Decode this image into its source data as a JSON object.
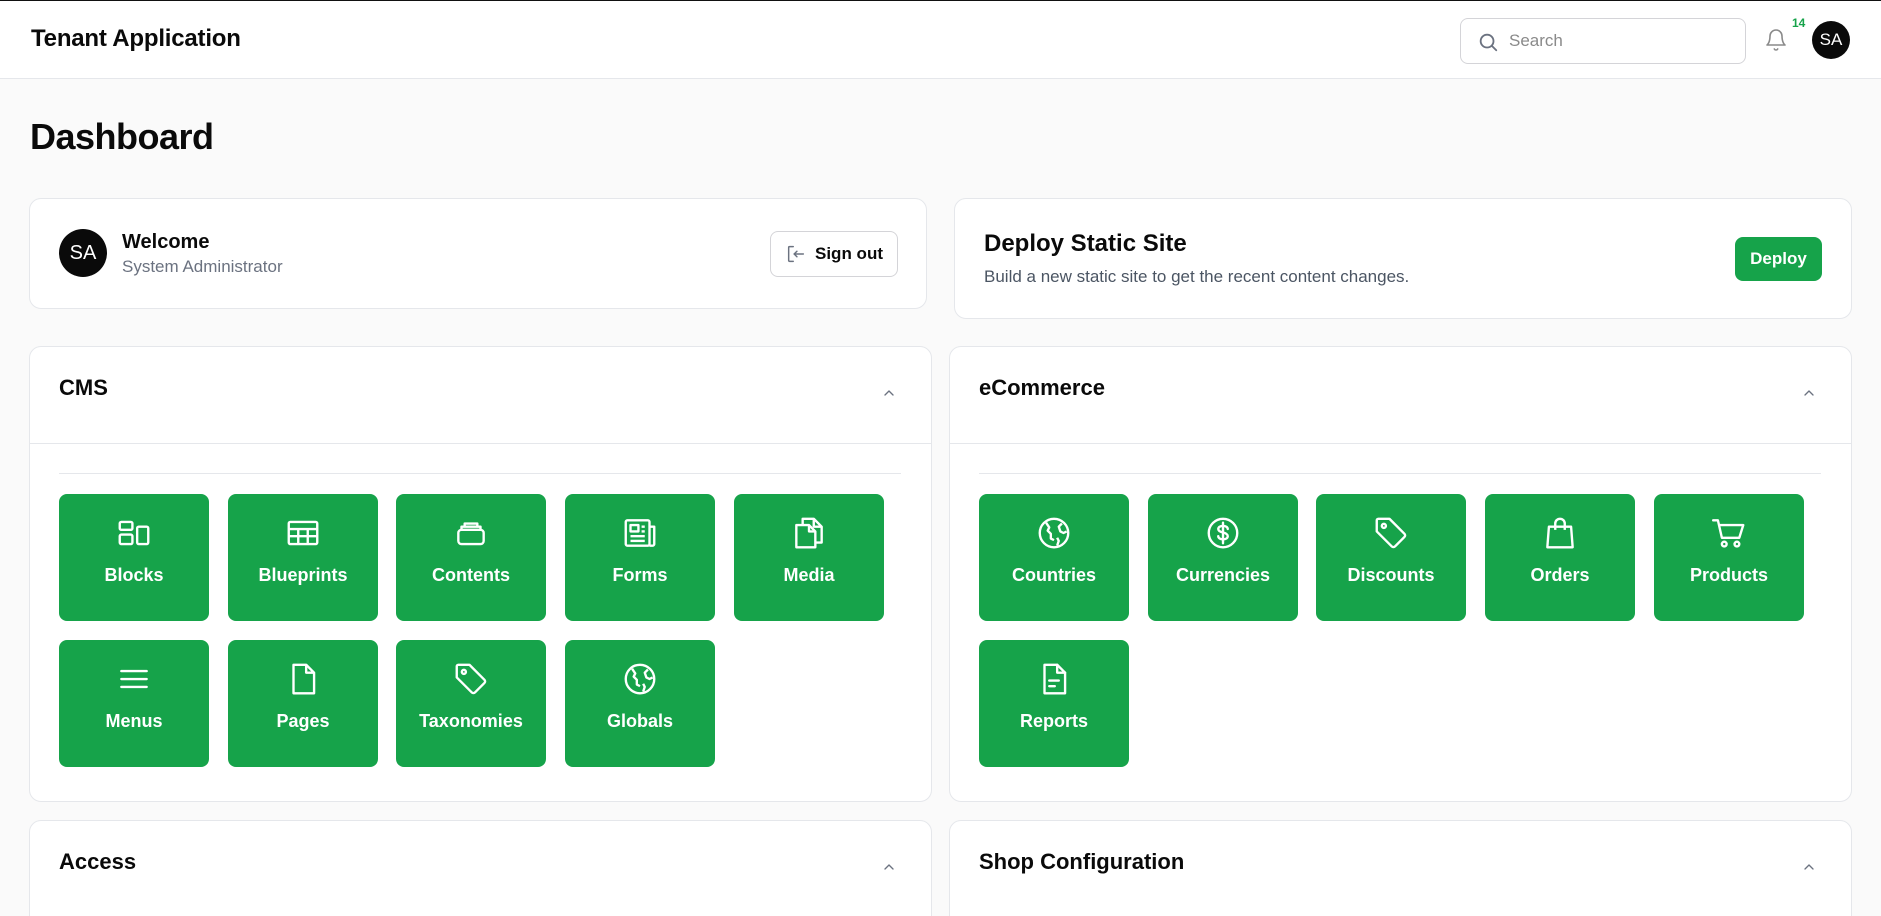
{
  "header": {
    "app_title": "Tenant Application",
    "search_placeholder": "Search",
    "notification_count": "14",
    "user_initials": "SA"
  },
  "page_title": "Dashboard",
  "welcome": {
    "initials": "SA",
    "title": "Welcome",
    "role": "System Administrator",
    "signout_label": "Sign out"
  },
  "deploy": {
    "title": "Deploy Static Site",
    "description": "Build a new static site to get the recent content changes.",
    "button_label": "Deploy"
  },
  "sections": {
    "cms": {
      "title": "CMS",
      "tiles": [
        {
          "label": "Blocks",
          "icon": "blocks-icon"
        },
        {
          "label": "Blueprints",
          "icon": "table-icon"
        },
        {
          "label": "Contents",
          "icon": "stack-icon"
        },
        {
          "label": "Forms",
          "icon": "newspaper-icon"
        },
        {
          "label": "Media",
          "icon": "documents-icon"
        },
        {
          "label": "Menus",
          "icon": "menu-icon"
        },
        {
          "label": "Pages",
          "icon": "page-icon"
        },
        {
          "label": "Taxonomies",
          "icon": "tag-icon"
        },
        {
          "label": "Globals",
          "icon": "globe-icon"
        }
      ]
    },
    "ecommerce": {
      "title": "eCommerce",
      "tiles": [
        {
          "label": "Countries",
          "icon": "globe-icon"
        },
        {
          "label": "Currencies",
          "icon": "dollar-icon"
        },
        {
          "label": "Discounts",
          "icon": "tag-icon"
        },
        {
          "label": "Orders",
          "icon": "shopping-bag-icon"
        },
        {
          "label": "Products",
          "icon": "cart-icon"
        },
        {
          "label": "Reports",
          "icon": "report-icon"
        }
      ]
    },
    "access": {
      "title": "Access"
    },
    "shop_configuration": {
      "title": "Shop Configuration"
    }
  },
  "colors": {
    "accent": "#16a34a",
    "page_background": "#fafafa",
    "card_border": "#e5e7eb"
  }
}
